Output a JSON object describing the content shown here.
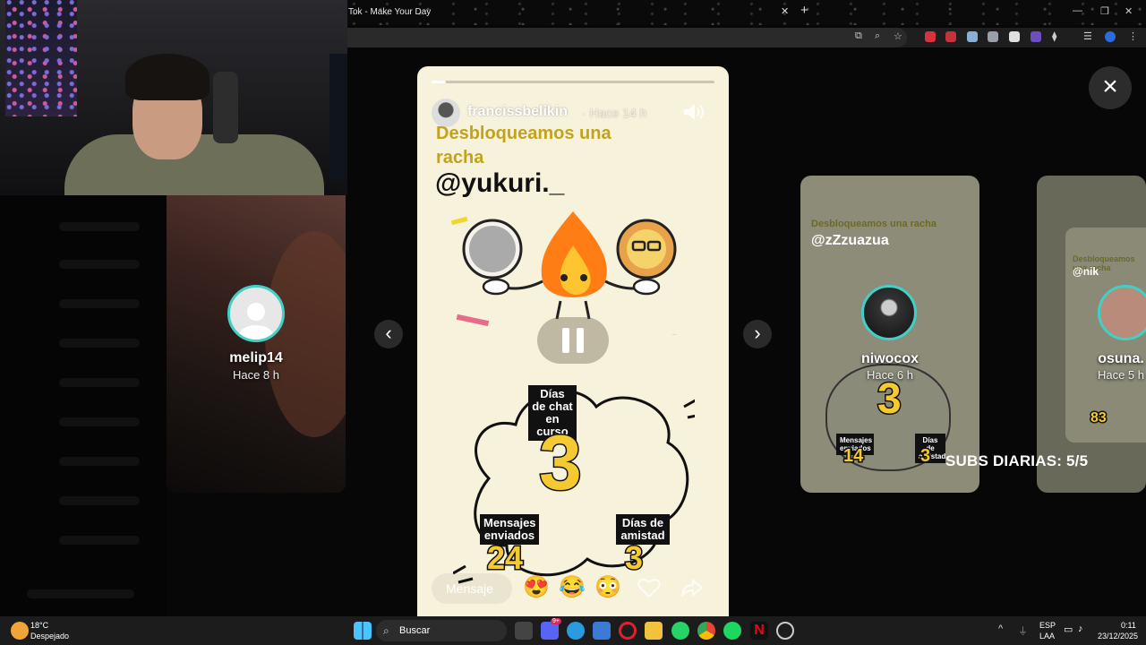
{
  "browser": {
    "tab_title": "Tok - Make Your Day",
    "tab_close": "✕",
    "new_tab": "+",
    "minimize": "—",
    "maximize": "❐",
    "close": "✕"
  },
  "background_story": {
    "username": "melip14",
    "time": "Hace 8 h"
  },
  "story": {
    "progress_fraction": 0.05,
    "username": "francissbelikin",
    "time": "· Hace 14 h",
    "headline": "Desbloqueamos una racha",
    "mention": "@yukuri._",
    "chat_days_label": "Días de chat en curso",
    "chat_days_value": "3",
    "messages_label": "Mensajes enviados",
    "messages_value": "24",
    "friendship_label": "Días de amistad",
    "friendship_value": "3",
    "message_placeholder": "Mensaje",
    "reactions": [
      "😍",
      "😂",
      "😳"
    ]
  },
  "next_story": {
    "headline": "Desbloqueamos una racha",
    "mention": "@zZzuazua",
    "username": "niwocox",
    "time": "Hace 6 h",
    "messages_label": "Mensajes enviados",
    "messages_value": "14",
    "friendship_label": "Días de amistad",
    "friendship_value": "3",
    "chat_value": "3"
  },
  "next_story_2": {
    "headline": "Desbloqueamos una racha",
    "mention": "@nik",
    "username": "osuna.",
    "time": "Hace 5 h",
    "value": "83"
  },
  "overlay": {
    "subs_text": "SUBS DIARIAS: 5/5"
  },
  "controls": {
    "prev": "‹",
    "next": "›",
    "close": "×"
  },
  "taskbar": {
    "weather_temp": "18°C",
    "weather_desc": "Despejado",
    "search_label": "Buscar",
    "lang_line1": "ESP",
    "lang_line2": "LAA",
    "time": "0:11",
    "date": "23/12/2025",
    "discord_badge": "9+"
  },
  "colors": {
    "accent_ring": "#41d0c6",
    "streak_yellow": "#f4c931",
    "headline_gold": "#c3a31c"
  }
}
